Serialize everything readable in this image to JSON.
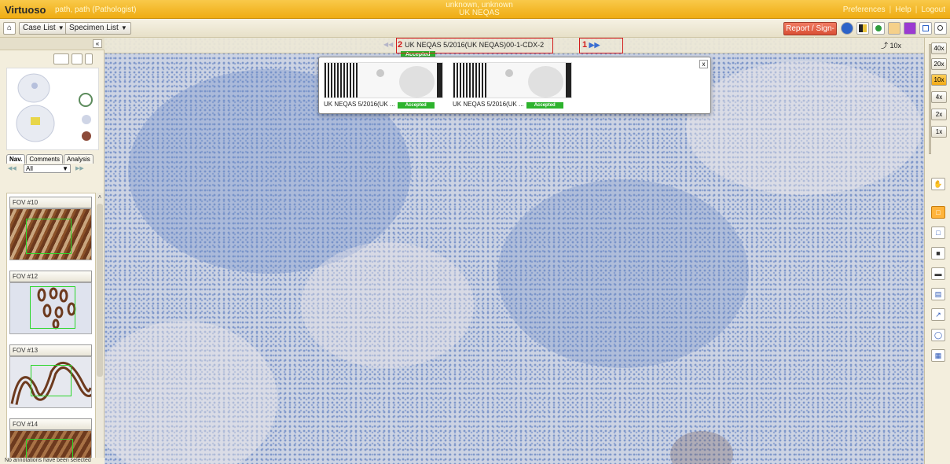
{
  "header": {
    "brand": "Virtuoso",
    "user": "path, path (Pathologist)",
    "center_line1": "unknown, unknown",
    "center_line2": "UK NEQAS",
    "links": [
      "Preferences",
      "Help",
      "Logout"
    ]
  },
  "navbar": {
    "breadcrumb": [
      "Case List",
      "Specimen List"
    ],
    "report_button": "Report / Sign-out"
  },
  "viewer": {
    "case_marker": "2",
    "case_title": "UK NEQAS 5/2016(UK NEQAS)00-1-CDX-2",
    "case_status": "Accepted",
    "nav_marker": "1",
    "current_zoom": "10x"
  },
  "popup": {
    "close": "x",
    "slides": [
      {
        "caption": "UK NEQAS 5/2016(UK ...",
        "status": "Accepted"
      },
      {
        "caption": "UK NEQAS 5/2016(UK ...",
        "status": "Accepted"
      }
    ]
  },
  "left_panel": {
    "tabs": [
      "Nav.",
      "Comments",
      "Analysis"
    ],
    "filter_value": "All",
    "fov_items": [
      "FOV #10",
      "FOV #12",
      "FOV #13",
      "FOV #14"
    ],
    "status": "No annotations have been selected"
  },
  "zoom_levels": [
    "40x",
    "20x",
    "10x",
    "4x",
    "2x",
    "1x"
  ],
  "active_zoom": "10x"
}
